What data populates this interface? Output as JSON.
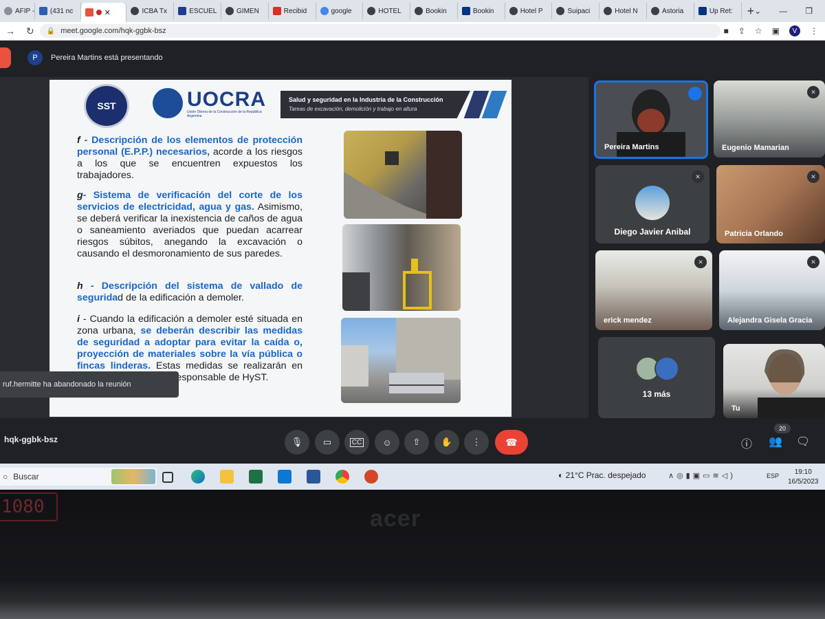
{
  "browser": {
    "tabs": [
      "AFIP - /",
      "(431 nc",
      "",
      "ICBA Tx",
      "ESCUEL",
      "GIMEN",
      "Recibid",
      "google",
      "HOTEL",
      "Bookin",
      "Bookin",
      "Hotel P",
      "Suipaci",
      "Hotel N",
      "Astoria",
      "Up Ret:"
    ],
    "url": "meet.google.com/hqk-ggbk-bsz",
    "avatar_letter": "V"
  },
  "meet": {
    "presenter_initial": "P",
    "presenting_text": "Pereira Martins está presentando",
    "meeting_code": "hqk-ggbk-bsz",
    "participants_count": "20",
    "toast": "ruf.hermitte ha abandonado la reunión",
    "tiles": [
      {
        "name": "Pereira Martins"
      },
      {
        "name": "Eugenio Mamarian"
      },
      {
        "name": "Diego Javier Anibal"
      },
      {
        "name": "Patricia Orlando"
      },
      {
        "name": "erick mendez"
      },
      {
        "name": "Alejandra Gisela Gracia"
      },
      {
        "name": "13 más"
      },
      {
        "name": "Tu"
      }
    ]
  },
  "slide": {
    "logo_sst": "SST",
    "logo_uocra": "UOCRA",
    "logo_uocra_sub": "Unión Obrera de la Construcción de la República Argentina",
    "banner_title": "Salud y seguridad en la Industria de la Construcción",
    "banner_subtitle": "Tareas de excavación, demolición y trabajo en altura",
    "f_letter": "f",
    "f_title": " - Descripción de los elementos de protección personal (E.P.P.) necesarios,",
    "f_text": " acorde a los riesgos a los que se encuentren expuestos los trabajadores.",
    "g_letter": "g",
    "g_title": "- Sistema de verificación del corte de los servicios de electricidad, agua y gas.",
    "g_text": " Asimismo, se deberá verificar la inexistencia de caños de agua o saneamiento averiados que puedan acarrear riesgos súbitos, anegando la excavación o causando el desmoronamiento de sus paredes.",
    "h_letter": "h",
    "h_title": " - Descripción del sistema de vallado de segurida",
    "h_text": "d de la edificación a demoler.",
    "i_letter": "i",
    "i_text1": " - Cuando la edificación a demoler esté situada en zona urbana, ",
    "i_title": "se deberán describir las medidas de seguridad a adoptar para evitar la caída o, proyección de materiales sobre la vía pública o fincas linderas.",
    "i_text2": " Estas medidas se realizarán en forma conjunta con el responsable de HyST."
  },
  "taskbar": {
    "search": "Buscar",
    "temperature": "21°C",
    "weather": "Prac. despejado",
    "lang": "ESP",
    "time": "19:10",
    "date": "16/5/2023"
  },
  "laptop": {
    "brand": "acer",
    "badge": "1080"
  }
}
